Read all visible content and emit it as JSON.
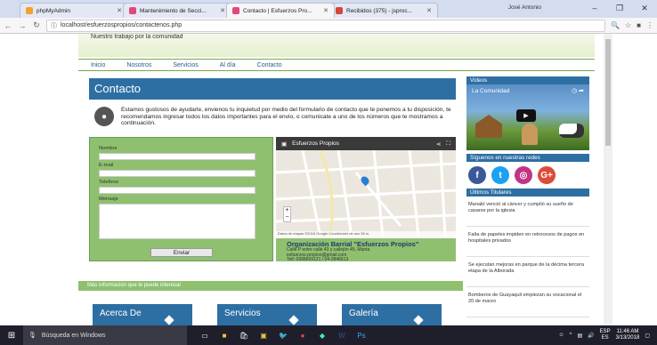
{
  "browser": {
    "tabs": [
      {
        "label": "phpMyAdmin",
        "color": "#f1a130"
      },
      {
        "label": "Mantenimiento de Secci...",
        "color": "#e2487b"
      },
      {
        "label": "Contacto | Esfuerzos Pro...",
        "color": "#e2487b",
        "active": true
      },
      {
        "label": "Recibidos (375) - jsproc...",
        "color": "#d44638"
      }
    ],
    "user_label": "José Antonio",
    "url": "localhost/esfuerzospropios/contactenos.php"
  },
  "page": {
    "header_subtitle": "Nuestro trabajo por la comunidad",
    "nav": [
      "Inicio",
      "Nosotros",
      "Servicios",
      "Al día",
      "Contacto"
    ],
    "title": "Contacto",
    "intro": "Estamos gustosos de ayudarle, envienos tu inquietud por medio del formulario de contacto que te ponemos a tu disposición, te recomendamos ingresar todos los datos importantes para el envio, o comunicate a uno de los números que te mostramos a continuación.",
    "form": {
      "fields": [
        "Nombre",
        "E-mail",
        "Telefono",
        "Mensaje"
      ],
      "submit_label": "Enviar"
    },
    "map": {
      "title": "Esfuerzos Propios",
      "footer": "Datos de mapas ©2018 Google   Condiciones de uso   50 m"
    },
    "org": {
      "name": "Organización Barrial \"Esfuerzos Propios\"",
      "lines": [
        "Calle P entre calle 43 y callejón 45, Manta",
        "esfuerzos.propios@gmail.com",
        "Telf: 0998669121 / 04-2846613"
      ]
    },
    "more_info": "Más información que le puede interesar",
    "cards": [
      "Acerca De",
      "Servicios",
      "Galería"
    ]
  },
  "sidebar": {
    "videos_title": "Videos",
    "video_caption": "La Comunidad",
    "social_title": "Síguenos en nuestras redes",
    "news_title": "Últimos Titulares",
    "news": [
      "Manabí venció al cáncer y cumplió su sueño de casarse por la iglesia",
      "Falta de papeles impiden en retrocesos de pagos en hospitales privados",
      "Se ejecutan mejoras en parque de la décima tercera etapa de la Alborada",
      "Bomberos de Guayaquil empiezan su vocacional el 20 de marzo"
    ]
  },
  "taskbar": {
    "search_placeholder": "Búsqueda en Windows",
    "lang": "ESP",
    "region": "ES",
    "time": "11:46 AM",
    "date": "3/13/2018"
  }
}
